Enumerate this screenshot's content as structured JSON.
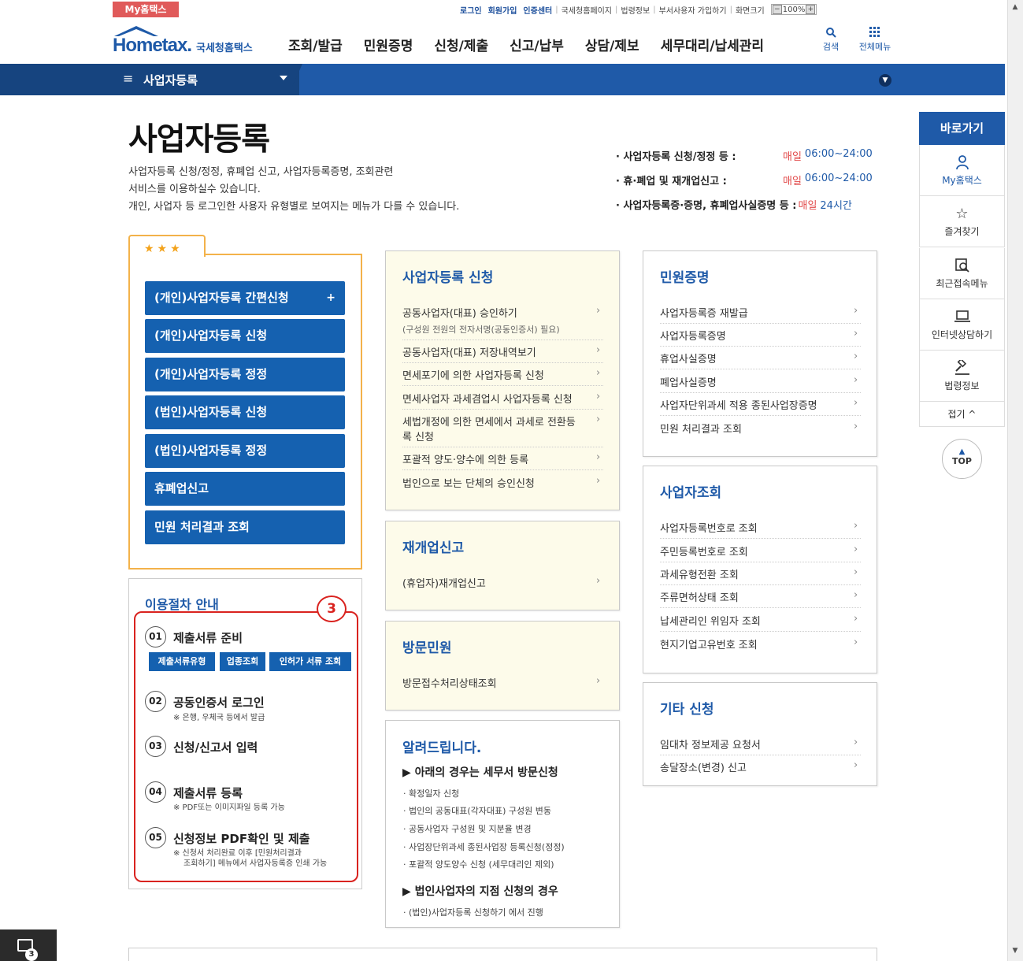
{
  "top": {
    "my_hometax": "My홈택스",
    "util": [
      "로그인",
      "회원가입",
      "인증센터",
      "국세청홈페이지",
      "법령정보",
      "부서사용자 가입하기",
      "화면크기"
    ],
    "zoom": "100%"
  },
  "header": {
    "logo_main": "Hometax.",
    "logo_sub": "국세청홈택스",
    "menu": [
      "조회/발급",
      "민원증명",
      "신청/제출",
      "신고/납부",
      "상담/제보",
      "세무대리/납세관리"
    ],
    "search_label": "검색",
    "allmenu_label": "전체메뉴"
  },
  "navbar": {
    "title": "사업자등록"
  },
  "page": {
    "title": "사업자등록",
    "desc": [
      "사업자등록 신청/정정, 휴폐업 신고, 사업자등록증명, 조회관련",
      "서비스를 이용하실수 있습니다.",
      "개인, 사업자 등 로그인한 사용자 유형별로 보여지는 메뉴가 다를 수 있습니다."
    ],
    "hours": [
      {
        "label": "· 사업자등록 신청/정정 등 :",
        "day": "매일",
        "time": "06:00~24:00"
      },
      {
        "label": "· 휴·폐업 및 재개업신고 :",
        "day": "매일",
        "time": "06:00~24:00"
      },
      {
        "label": "· 사업자등록증·증명, 휴폐업사실증명 등 :",
        "day": "매일",
        "time": "24시간"
      }
    ]
  },
  "quick": {
    "stars": "★★★",
    "buttons": [
      "(개인)사업자등록 간편신청",
      "(개인)사업자등록 신청",
      "(개인)사업자등록 정정",
      "(법인)사업자등록 신청",
      "(법인)사업자등록 정정",
      "휴폐업신고",
      "민원 처리결과 조회"
    ],
    "plus": "+"
  },
  "procedure": {
    "title": "이용절차 안내",
    "badge": "3",
    "steps": [
      {
        "num": "01",
        "title": "제출서류 준비",
        "note": ""
      },
      {
        "num": "02",
        "title": "공동인증서 로그인",
        "note": "※ 은행, 우체국 등에서 발급"
      },
      {
        "num": "03",
        "title": "신청/신고서 입력",
        "note": ""
      },
      {
        "num": "04",
        "title": "제출서류 등록",
        "note": "※ PDF또는 이미지파일 등록 가능"
      },
      {
        "num": "05",
        "title": "신청정보 PDF확인 및 제출",
        "note": "※ 신청서 처리완료 이후 [민원처리결과",
        "note2": "조회하기] 메뉴에서 사업자등록증 인쇄 가능"
      }
    ],
    "step1_buttons": [
      "제출서류유형",
      "업종조회",
      "인허가 서류 조회"
    ]
  },
  "panels": {
    "reg": {
      "title": "사업자등록 신청",
      "links": [
        "공동사업자(대표) 승인하기",
        "공동사업자(대표) 저장내역보기",
        "면세포기에 의한 사업자등록 신청",
        "면세사업자 과세겸업시 사업자등록 신청",
        "세법개정에 의한 면세에서 과세로 전환등",
        "포괄적 양도·양수에 의한 등록",
        "법인으로 보는 단체의 승인신청"
      ],
      "link0_sub": "(구성원 전원의 전자서명(공동인증서) 필요)",
      "link4_line2": "록 신청"
    },
    "reopen": {
      "title": "재개업신고",
      "links": [
        "(휴업자)재개업신고"
      ]
    },
    "visit": {
      "title": "방문민원",
      "links": [
        "방문접수처리상태조회"
      ]
    },
    "notice": {
      "title": "알려드립니다.",
      "h1": "▶ 아래의 경우는 세무서 방문신청",
      "items1": [
        "· 확정일자 신청",
        "· 법인의 공동대표(각자대표) 구성원 변동",
        "· 공동사업자 구성원 및 지분율 변경",
        "· 사업장단위과세 종된사업장 등록신청(정정)",
        "· 포괄적 양도양수 신청 (세무대리인 제외)"
      ],
      "h2": "▶ 법인사업자의 지점 신청의 경우",
      "items2": [
        "· (법인)사업자등록 신청하기 에서 진행"
      ]
    },
    "cert": {
      "title": "민원증명",
      "links": [
        "사업자등록증 재발급",
        "사업자등록증명",
        "휴업사실증명",
        "폐업사실증명",
        "사업자단위과세 적용 종된사업장증명",
        "민원 처리결과 조회"
      ]
    },
    "lookup": {
      "title": "사업자조회",
      "links": [
        "사업자등록번호로 조회",
        "주민등록번호로 조회",
        "과세유형전환 조회",
        "주류면허상태 조회",
        "납세관리인 위임자 조회",
        "현지기업고유번호 조회"
      ]
    },
    "other": {
      "title": "기타 신청",
      "links": [
        "임대차 정보제공 요청서",
        "송달장소(변경) 신고"
      ]
    }
  },
  "sidebar": {
    "head": "바로가기",
    "items": [
      "My홈택스",
      "즐겨찾기",
      "최근접속메뉴",
      "인터넷상담하기",
      "법령정보"
    ],
    "fold": "접기 ^",
    "top": "TOP"
  },
  "taskbar": {
    "badge": "3"
  },
  "colors": {
    "brand": "#1f5aa8",
    "accent": "#f3b24a",
    "highlight": "#d9231f"
  }
}
